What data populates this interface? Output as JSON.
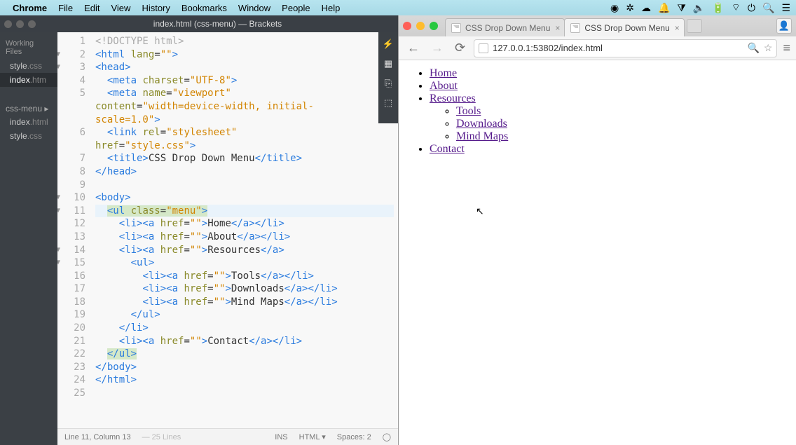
{
  "mac_menu": {
    "app": "Chrome",
    "items": [
      "File",
      "Edit",
      "View",
      "History",
      "Bookmarks",
      "Window",
      "People",
      "Help"
    ]
  },
  "brackets": {
    "title": "index.html (css-menu) — Brackets",
    "sidebar": {
      "working_label": "Working Files",
      "working_files": [
        {
          "name": "style",
          "ext": ".css"
        },
        {
          "name": "index",
          "ext": ".htm"
        }
      ],
      "folder": "css-menu ▸",
      "project_files": [
        {
          "name": "index",
          "ext": ".html"
        },
        {
          "name": "style",
          "ext": ".css"
        }
      ]
    },
    "code_lines": [
      {
        "n": 1,
        "fold": "",
        "html": "<span class='doctype'>&lt;!DOCTYPE html&gt;</span>"
      },
      {
        "n": 2,
        "fold": "▼",
        "html": "<span class='tag'>&lt;html</span> <span class='attr'>lang</span>=<span class='str'>\"\"</span><span class='tag'>&gt;</span>"
      },
      {
        "n": 3,
        "fold": "▼",
        "html": "<span class='tag'>&lt;head&gt;</span>"
      },
      {
        "n": 4,
        "fold": "",
        "html": "  <span class='tag'>&lt;meta</span> <span class='attr'>charset</span>=<span class='str'>\"UTF-8\"</span><span class='tag'>&gt;</span>"
      },
      {
        "n": 5,
        "fold": "",
        "html": "  <span class='tag'>&lt;meta</span> <span class='attr'>name</span>=<span class='str'>\"viewport\"</span>"
      },
      {
        "n": "",
        "fold": "",
        "html": "<span class='attr'>content</span>=<span class='str'>\"width=device-width, initial-</span>"
      },
      {
        "n": "",
        "fold": "",
        "html": "<span class='str'>scale=1.0\"</span><span class='tag'>&gt;</span>"
      },
      {
        "n": 6,
        "fold": "",
        "html": "  <span class='tag'>&lt;link</span> <span class='attr'>rel</span>=<span class='str'>\"stylesheet\"</span>"
      },
      {
        "n": "",
        "fold": "",
        "html": "<span class='attr'>href</span>=<span class='str'>\"style.css\"</span><span class='tag'>&gt;</span>"
      },
      {
        "n": 7,
        "fold": "",
        "html": "  <span class='tag'>&lt;title&gt;</span><span class='txt'>CSS Drop Down Menu</span><span class='tag'>&lt;/title&gt;</span>"
      },
      {
        "n": 8,
        "fold": "",
        "html": "<span class='tag'>&lt;/head&gt;</span>"
      },
      {
        "n": 9,
        "fold": "",
        "html": ""
      },
      {
        "n": 10,
        "fold": "▼",
        "html": "<span class='tag'>&lt;body&gt;</span>"
      },
      {
        "n": 11,
        "fold": "▼",
        "hl": true,
        "html": "  <span class='curtag'><span class='tag'>&lt;ul</span> <span class='attr'>class</span>=<span class='str'>\"menu\"</span><span class='tag'>&gt;</span></span>"
      },
      {
        "n": 12,
        "fold": "",
        "html": "    <span class='tag'>&lt;li&gt;&lt;a</span> <span class='attr'>href</span>=<span class='str'>\"\"</span><span class='tag'>&gt;</span><span class='txt'>Home</span><span class='tag'>&lt;/a&gt;&lt;/li&gt;</span>"
      },
      {
        "n": 13,
        "fold": "",
        "html": "    <span class='tag'>&lt;li&gt;&lt;a</span> <span class='attr'>href</span>=<span class='str'>\"\"</span><span class='tag'>&gt;</span><span class='txt'>About</span><span class='tag'>&lt;/a&gt;&lt;/li&gt;</span>"
      },
      {
        "n": 14,
        "fold": "▼",
        "html": "    <span class='tag'>&lt;li&gt;&lt;a</span> <span class='attr'>href</span>=<span class='str'>\"\"</span><span class='tag'>&gt;</span><span class='txt'>Resources</span><span class='tag'>&lt;/a&gt;</span>"
      },
      {
        "n": 15,
        "fold": "▼",
        "html": "      <span class='tag'>&lt;ul&gt;</span>"
      },
      {
        "n": 16,
        "fold": "",
        "html": "        <span class='tag'>&lt;li&gt;&lt;a</span> <span class='attr'>href</span>=<span class='str'>\"\"</span><span class='tag'>&gt;</span><span class='txt'>Tools</span><span class='tag'>&lt;/a&gt;&lt;/li&gt;</span>"
      },
      {
        "n": 17,
        "fold": "",
        "html": "        <span class='tag'>&lt;li&gt;&lt;a</span> <span class='attr'>href</span>=<span class='str'>\"\"</span><span class='tag'>&gt;</span><span class='txt'>Downloads</span><span class='tag'>&lt;/a&gt;&lt;/li&gt;</span>"
      },
      {
        "n": 18,
        "fold": "",
        "html": "        <span class='tag'>&lt;li&gt;&lt;a</span> <span class='attr'>href</span>=<span class='str'>\"\"</span><span class='tag'>&gt;</span><span class='txt'>Mind Maps</span><span class='tag'>&lt;/a&gt;&lt;/li&gt;</span>"
      },
      {
        "n": 19,
        "fold": "",
        "html": "      <span class='tag'>&lt;/ul&gt;</span>"
      },
      {
        "n": 20,
        "fold": "",
        "html": "    <span class='tag'>&lt;/li&gt;</span>"
      },
      {
        "n": 21,
        "fold": "",
        "html": "    <span class='tag'>&lt;li&gt;&lt;a</span> <span class='attr'>href</span>=<span class='str'>\"\"</span><span class='tag'>&gt;</span><span class='txt'>Contact</span><span class='tag'>&lt;/a&gt;&lt;/li&gt;</span>"
      },
      {
        "n": 22,
        "fold": "",
        "html": "  <span class='curtag'><span class='tag'>&lt;/ul&gt;</span></span>"
      },
      {
        "n": 23,
        "fold": "",
        "html": "<span class='tag'>&lt;/body&gt;</span>"
      },
      {
        "n": 24,
        "fold": "",
        "html": "<span class='tag'>&lt;/html&gt;</span>"
      },
      {
        "n": 25,
        "fold": "",
        "html": ""
      }
    ],
    "status": {
      "pos": "Line 11, Column 13",
      "lines": "— 25 Lines",
      "insert": "INS",
      "lang": "HTML ▾",
      "spaces": "Spaces: 2"
    }
  },
  "chrome": {
    "tabs": [
      {
        "title": "CSS Drop Down Menu",
        "active": false
      },
      {
        "title": "CSS Drop Down Menu",
        "active": true
      }
    ],
    "url": "127.0.0.1:53802/index.html",
    "page_links": {
      "top": [
        "Home",
        "About",
        "Resources"
      ],
      "sub": [
        "Tools",
        "Downloads",
        "Mind Maps"
      ],
      "after": [
        "Contact"
      ]
    }
  }
}
